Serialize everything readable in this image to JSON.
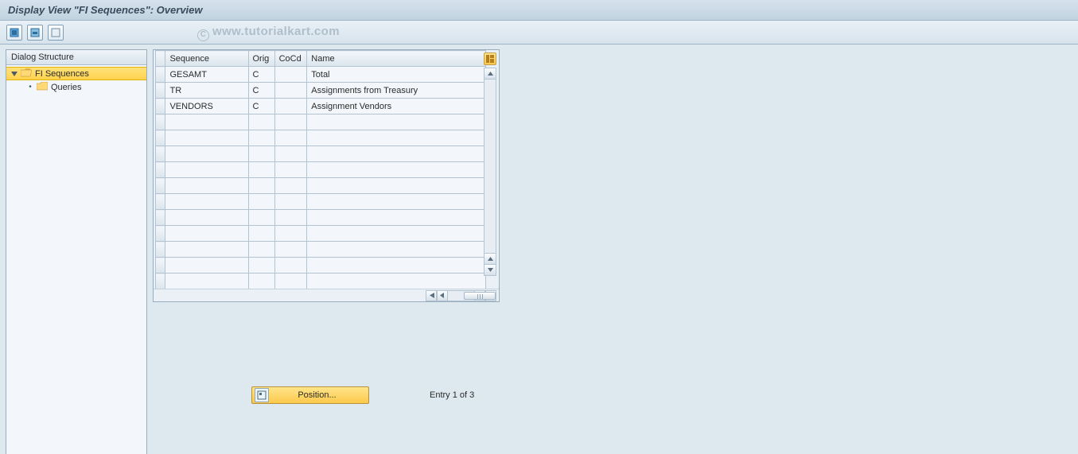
{
  "title": "Display View \"FI Sequences\": Overview",
  "watermark": "www.tutorialkart.com",
  "toolbar_icons": [
    "select-all-icon",
    "select-block-icon",
    "deselect-icon"
  ],
  "tree": {
    "header": "Dialog Structure",
    "nodes": [
      {
        "label": "FI Sequences",
        "selected": true,
        "expanded": true,
        "icon": "folder-open"
      },
      {
        "label": "Queries",
        "selected": false,
        "expanded": false,
        "icon": "folder-closed",
        "indent": 1
      }
    ]
  },
  "table": {
    "columns": [
      "Sequence",
      "Orig",
      "CoCd",
      "Name"
    ],
    "rows": [
      {
        "sequence": "GESAMT",
        "orig": "C",
        "cocd": "",
        "name": "Total"
      },
      {
        "sequence": "TR",
        "orig": "C",
        "cocd": "",
        "name": "Assignments from Treasury"
      },
      {
        "sequence": "VENDORS",
        "orig": "C",
        "cocd": "",
        "name": "Assignment Vendors"
      }
    ],
    "empty_rows": 11
  },
  "position_button": "Position...",
  "entry_count": "Entry 1 of 3"
}
